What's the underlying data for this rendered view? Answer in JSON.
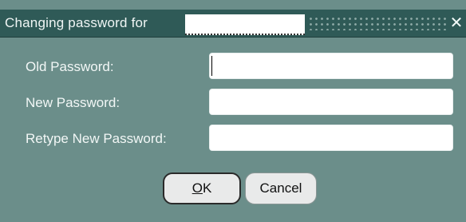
{
  "dialog": {
    "title_prefix": "Changing password for",
    "close_glyph": "✕"
  },
  "form": {
    "old_password_label": "Old Password:",
    "new_password_label": "New Password:",
    "retype_password_label": "Retype New Password:",
    "old_password_value": "",
    "new_password_value": "",
    "retype_password_value": ""
  },
  "buttons": {
    "ok_label_mnemonic": "O",
    "ok_label_rest": "K",
    "cancel_label": "Cancel"
  }
}
